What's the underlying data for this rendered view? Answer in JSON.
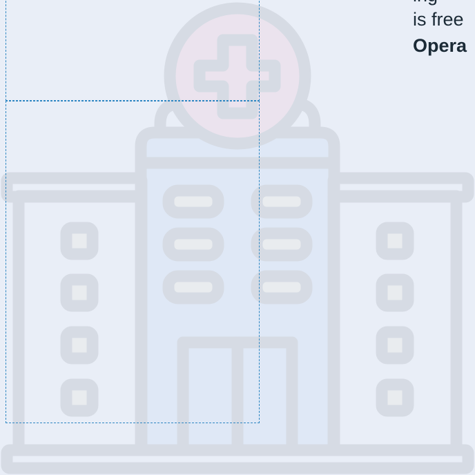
{
  "copy": {
    "line1": "ing",
    "line2": "is free",
    "line3": "Opera"
  },
  "illustration": {
    "icon": "hospital-building-icon",
    "symbol": "medical-cross-icon",
    "colors": {
      "background": "#e9eef7",
      "outline": "#d6dbe4",
      "center_fill": "#dfe8f6",
      "cross_fill": "#ebe3ee",
      "window_fill": "#e9ecef",
      "guide": "#2d86c2"
    }
  }
}
